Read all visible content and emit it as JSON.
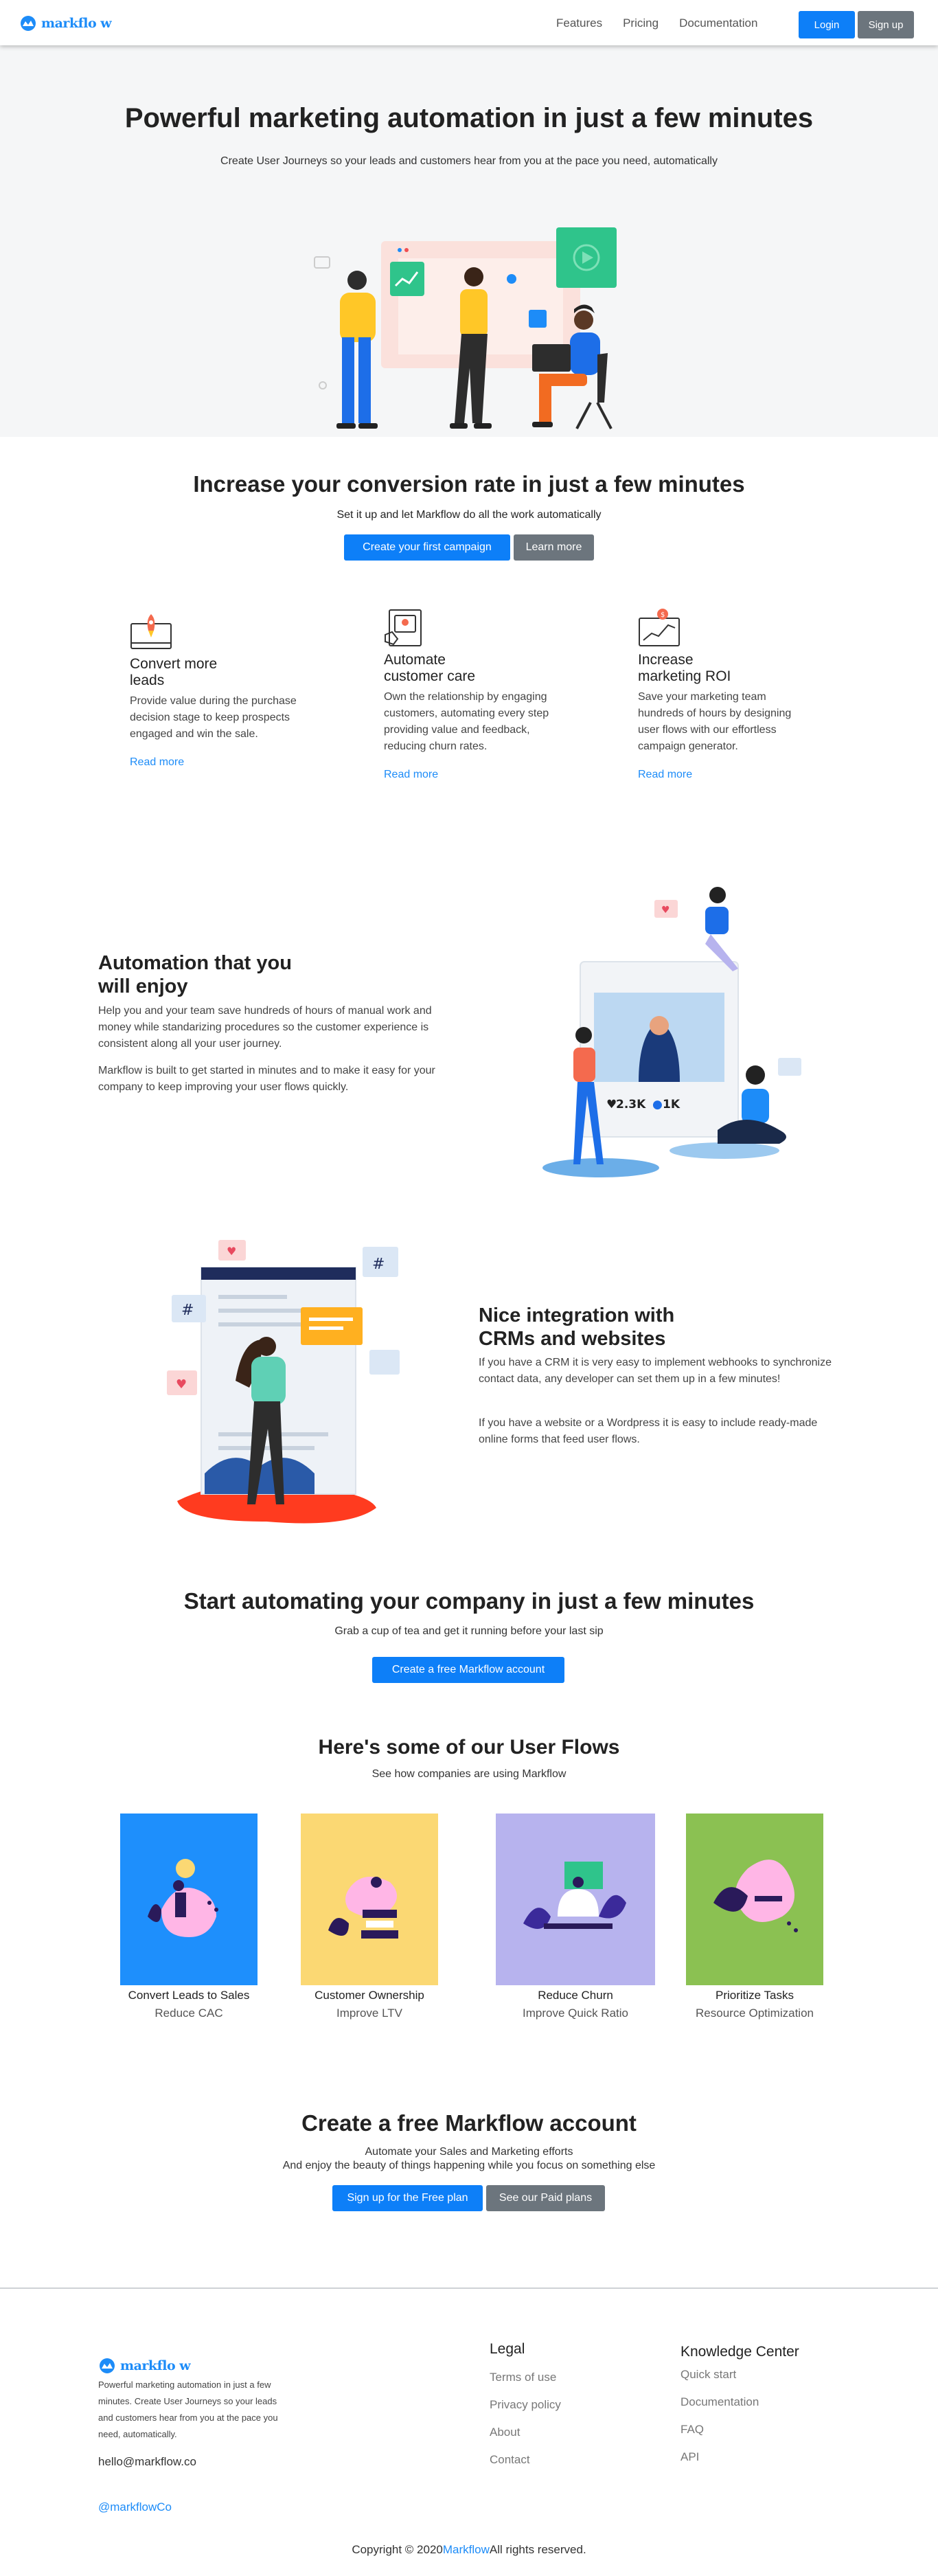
{
  "nav": {
    "brand": "markflo w",
    "links": [
      "Features",
      "Pricing",
      "Documentation"
    ],
    "login": "Login",
    "signup": "Sign up"
  },
  "hero": {
    "title": "Powerful marketing automation in just a few minutes",
    "subtitle": "Create User Journeys so your leads and customers hear from you at the pace you need, automatically"
  },
  "conversion": {
    "title": "Increase your conversion rate in just a few minutes",
    "subtitle": "Set it up and let Markflow do all the work automatically",
    "primary_button": "Create your first campaign",
    "secondary_button": "Learn more",
    "features": [
      {
        "icon": "rocket-icon",
        "title": "Convert more leads",
        "text": "Provide value during the purchase decision stage to keep prospects engaged and win the sale.",
        "link": "Read more"
      },
      {
        "icon": "customer-care-icon",
        "title": "Automate customer care",
        "text": "Own the relationship by engaging customers, automating every step providing value and feedback, reducing churn rates.",
        "link": "Read more"
      },
      {
        "icon": "roi-chart-icon",
        "title": "Increase marketing ROI",
        "text": "Save your marketing team hundreds of hours by designing user flows with our effortless campaign generator.",
        "link": "Read more"
      }
    ]
  },
  "automation": {
    "title": "Automation that you will enjoy",
    "paragraphs": [
      "Help you and your team save hundreds of hours of manual work and money while standarizing procedures so the customer experience is consistent along all your user journey.",
      "Markflow is built to get started in minutes and to make it easy for your company to keep improving your user flows quickly."
    ],
    "likes": "2.3K",
    "comments": "1K"
  },
  "integration": {
    "title": "Nice integration with CRMs and websites",
    "paragraphs": [
      "If you have a CRM it is very easy to implement webhooks to synchronize contact data, any developer can set them up in a few minutes!",
      "If you have a website or a Wordpress it is easy to include ready-made online forms that feed user flows."
    ]
  },
  "cta": {
    "title": "Start automating your company in just a few minutes",
    "subtitle": "Grab a cup of tea and get it running before your last sip",
    "button": "Create a free Markflow account"
  },
  "flows": {
    "title": "Here's some of our User Flows",
    "subtitle": "See how companies are using Markflow",
    "items": [
      {
        "title": "Convert Leads to Sales",
        "subtitle": "Reduce CAC",
        "color": "#1e8ffc"
      },
      {
        "title": "Customer Ownership",
        "subtitle": "Improve LTV",
        "color": "#fbd873"
      },
      {
        "title": "Reduce Churn",
        "subtitle": "Improve Quick Ratio",
        "color": "#b7b3ee"
      },
      {
        "title": "Prioritize Tasks",
        "subtitle": "Resource Optimization",
        "color": "#8bc152"
      }
    ]
  },
  "final": {
    "title": "Create a free Markflow account",
    "line1": "Automate your Sales and Marketing efforts",
    "line2": "And enjoy the beauty of things happening while you focus on something else",
    "primary_button": "Sign up for the Free plan",
    "secondary_button": "See our Paid plans"
  },
  "footer": {
    "brand": "markflo w",
    "description": "Powerful marketing automation in just a few minutes. Create User Journeys so your leads and customers hear from you at the pace you need, automatically.",
    "email": "hello@markflow.co",
    "social": "@markflowCo",
    "legal_title": "Legal",
    "legal_items": [
      "Terms of use",
      "Privacy policy",
      "About",
      "Contact"
    ],
    "knowledge_title": "Knowledge Center",
    "knowledge_items": [
      "Quick start",
      "Documentation",
      "FAQ",
      "API"
    ],
    "copyright_prefix": "Copyright © 2020",
    "copyright_brand": "Markflow",
    "copyright_suffix": "All rights reserved."
  },
  "colors": {
    "primary": "#0d7ff8",
    "secondary": "#6c757d",
    "link": "#1d8cf8",
    "hero_bg": "#f5f6f7"
  }
}
